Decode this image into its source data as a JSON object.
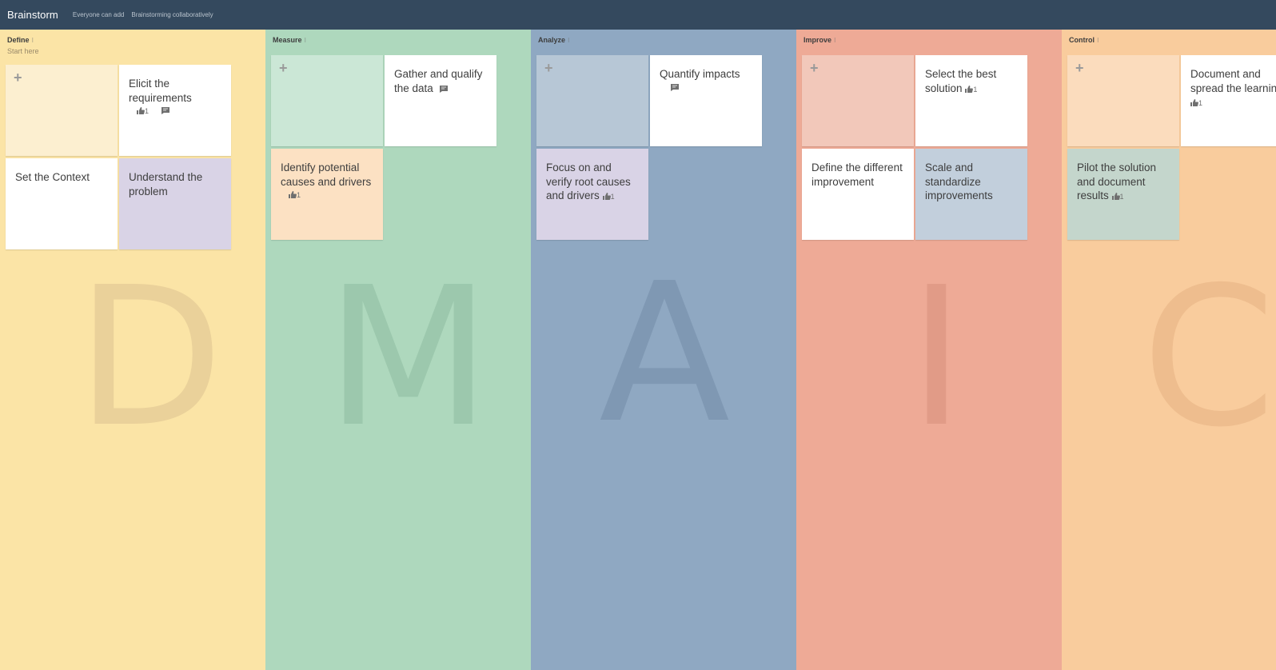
{
  "app": {
    "title": "Brainstorm",
    "meta": [
      "Everyone can add",
      "Brainstorming collaboratively"
    ]
  },
  "colors": {
    "topbar": "#34495e",
    "define": "#fbe4a6",
    "measure": "#aed8bd",
    "analyze": "#8fa8c2",
    "improve": "#eeaa96",
    "control": "#f9cc9d"
  },
  "columns": [
    {
      "title": "Define",
      "subtitle": "Start here",
      "letter": "D",
      "cards": [
        {
          "text": "Elicit the requirements",
          "likes": "1",
          "comment": true
        },
        {
          "text": "Set the Context"
        },
        {
          "text": "Understand the problem"
        }
      ]
    },
    {
      "title": "Measure",
      "letter": "M",
      "cards": [
        {
          "text": "Gather and qualify the data",
          "comment": true
        },
        {
          "text": "Identify potential causes and drivers",
          "likes": "1"
        }
      ]
    },
    {
      "title": "Analyze",
      "letter": "A",
      "cards": [
        {
          "text": "Quantify impacts",
          "comment": true
        },
        {
          "text": "Focus on and verify root causes and drivers",
          "likes": "1"
        }
      ]
    },
    {
      "title": "Improve",
      "letter": "I",
      "cards": [
        {
          "text": "Select the best solution",
          "likes": "1"
        },
        {
          "text": "Define the different improvement"
        },
        {
          "text": "Scale and standardize improvements"
        }
      ]
    },
    {
      "title": "Control",
      "letter": "C",
      "cards": [
        {
          "text": "Document and spread the learning",
          "likes": "1"
        },
        {
          "text": "Pilot the solution and document results",
          "likes": "1"
        }
      ]
    }
  ],
  "icons": {
    "add": "plus-icon",
    "like": "thumbs-up-icon",
    "comment": "comment-icon",
    "menu": "column-menu-icon"
  },
  "symbols": {
    "plus": "+",
    "menu": "⁝"
  }
}
